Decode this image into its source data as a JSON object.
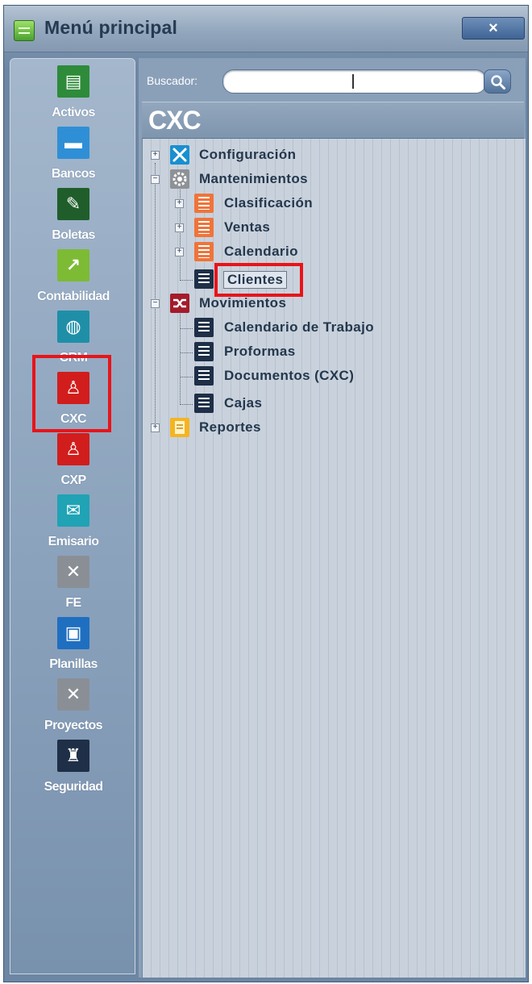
{
  "window": {
    "title": "Menú principal",
    "close_label": "×"
  },
  "modules": [
    {
      "label": "Activos",
      "icon": "cash-register-icon",
      "color": "#2e8b3a",
      "glyph": "▤"
    },
    {
      "label": "Bancos",
      "icon": "briefcase-icon",
      "color": "#2f8fd6",
      "glyph": "▬"
    },
    {
      "label": "Boletas",
      "icon": "teacher-desk-icon",
      "color": "#1f5e2a",
      "glyph": "✎"
    },
    {
      "label": "Contabilidad",
      "icon": "chart-line-icon",
      "color": "#7dbb35",
      "glyph": "↗"
    },
    {
      "label": "CRM",
      "icon": "globe-icon",
      "color": "#1f8fa8",
      "glyph": "◍"
    },
    {
      "label": "CXC",
      "icon": "person-receivables-icon",
      "color": "#d21d1d",
      "glyph": "♙"
    },
    {
      "label": "CXP",
      "icon": "person-payables-icon",
      "color": "#d21d1d",
      "glyph": "♙"
    },
    {
      "label": "Emisario",
      "icon": "envelope-icon",
      "color": "#1fa3b5",
      "glyph": "✉"
    },
    {
      "label": "FE",
      "icon": "tools-icon",
      "color": "#8a8f96",
      "glyph": "✕"
    },
    {
      "label": "Planillas",
      "icon": "document-icon",
      "color": "#1f6fc0",
      "glyph": "▣"
    },
    {
      "label": "Proyectos",
      "icon": "ruler-pencil-icon",
      "color": "#8a8f96",
      "glyph": "✕"
    },
    {
      "label": "Seguridad",
      "icon": "castle-icon",
      "color": "#1e2f47",
      "glyph": "♜"
    }
  ],
  "search": {
    "label": "Buscador:",
    "value": "",
    "placeholder": ""
  },
  "section": {
    "title": "CXC"
  },
  "tree": {
    "configuracion": "Configuración",
    "mantenimientos": "Mantenimientos",
    "clasificacion": "Clasificación",
    "ventas": "Ventas",
    "calendario": "Calendario",
    "clientes": "Clientes",
    "movimientos": "Movimientos",
    "calendario_trabajo": "Calendario de Trabajo",
    "proformas": "Proformas",
    "documentos": "Documentos (CXC)",
    "cajas": "Cajas",
    "reportes": "Reportes"
  },
  "highlight_color": "#e8141a"
}
